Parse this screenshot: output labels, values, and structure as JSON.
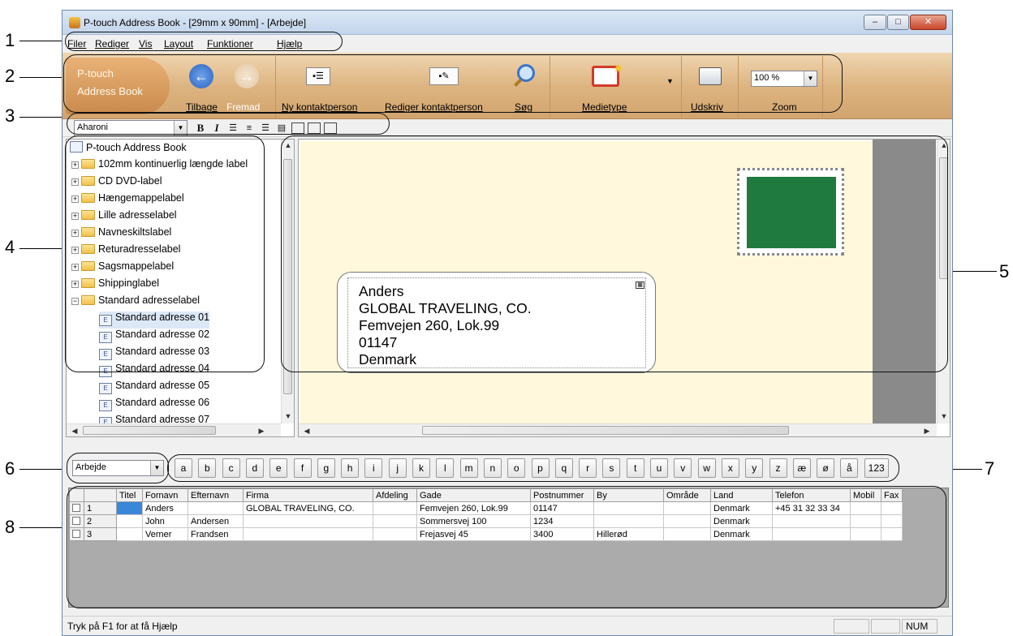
{
  "window": {
    "title": "P-touch Address Book - [29mm x 90mm] - [Arbejde]",
    "controls": {
      "minimize": "–",
      "maximize": "□",
      "close": "✕"
    }
  },
  "menu": [
    "Filer",
    "Rediger",
    "Vis",
    "Layout",
    "Funktioner",
    "Hjælp"
  ],
  "ribbon": {
    "logo_line1": "P-touch",
    "logo_line2": "Address Book",
    "buttons": {
      "back": "Tilbage",
      "forward": "Fremad",
      "new_contact": "Ny kontaktperson",
      "edit_contact": "Rediger kontaktperson",
      "search": "Søg",
      "media": "Medietype",
      "print": "Udskriv",
      "zoom": "Zoom"
    },
    "zoom_value": "100 %"
  },
  "format": {
    "font": "Aharoni",
    "bold": "B",
    "italic": "I"
  },
  "tree": {
    "root": "P-touch Address Book",
    "folders": [
      "102mm kontinuerlig længde label",
      "CD DVD-label",
      "Hængemappelabel",
      "Lille adresselabel",
      "Navneskiltslabel",
      "Returadresselabel",
      "Sagsmappelabel",
      "Shippinglabel",
      "Standard adresselabel"
    ],
    "children": [
      "Standard adresse 01",
      "Standard adresse 02",
      "Standard adresse 03",
      "Standard adresse 04",
      "Standard adresse 05",
      "Standard adresse 06",
      "Standard adresse 07"
    ]
  },
  "preview": {
    "lines": [
      "Anders",
      "GLOBAL TRAVELING, CO.",
      "Femvejen 260, Lok.99",
      "01147",
      "Denmark"
    ],
    "stamp_color": "#1f7a3f",
    "label_color": "#fff8dc"
  },
  "group_select": "Arbejde",
  "alphabet": [
    "a",
    "b",
    "c",
    "d",
    "e",
    "f",
    "g",
    "h",
    "i",
    "j",
    "k",
    "l",
    "m",
    "n",
    "o",
    "p",
    "q",
    "r",
    "s",
    "t",
    "u",
    "v",
    "w",
    "x",
    "y",
    "z",
    "æ",
    "ø",
    "å",
    "123"
  ],
  "grid": {
    "columns": [
      "Titel",
      "Fornavn",
      "Efternavn",
      "Firma",
      "Afdeling",
      "Gade",
      "Postnummer",
      "By",
      "Område",
      "Land",
      "Telefon",
      "Mobil",
      "Fax"
    ],
    "rows": [
      {
        "num": "1",
        "cells": [
          "",
          "Anders",
          "",
          "GLOBAL TRAVELING, CO.",
          "",
          "Femvejen 260, Lok.99",
          "01147",
          "",
          "",
          "Denmark",
          "+45 31 32 33 34",
          "",
          ""
        ]
      },
      {
        "num": "2",
        "cells": [
          "",
          "John",
          "Andersen",
          "",
          "",
          "Sommersvej 100",
          "1234",
          "",
          "",
          "Denmark",
          "",
          "",
          ""
        ]
      },
      {
        "num": "3",
        "cells": [
          "",
          "Verner",
          "Frandsen",
          "",
          "",
          "Frejasvej 45",
          "3400",
          "Hillerød",
          "",
          "Denmark",
          "",
          "",
          ""
        ]
      }
    ]
  },
  "status": {
    "help": "Tryk på F1 for at få Hjælp",
    "num": "NUM"
  },
  "callouts": [
    "1",
    "2",
    "3",
    "4",
    "5",
    "6",
    "7",
    "8"
  ]
}
